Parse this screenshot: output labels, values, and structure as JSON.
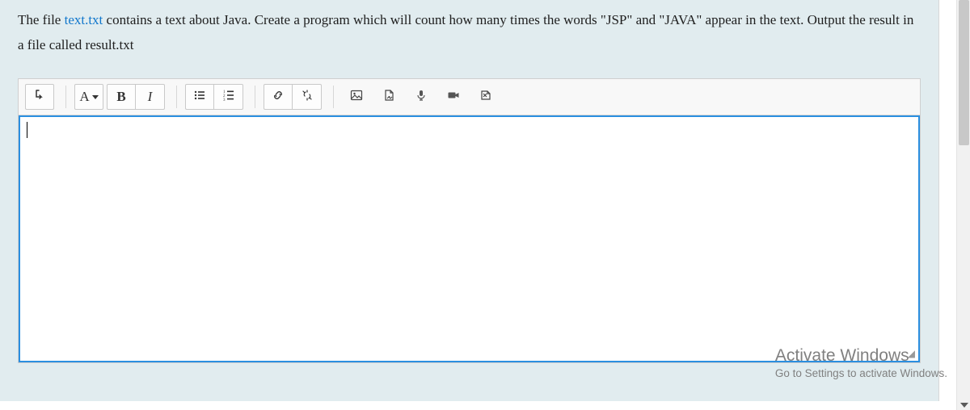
{
  "question": {
    "prefix": "The file ",
    "file_link": "text.txt",
    "suffix": " contains a text about Java. Create a program which will count how many times the words \"JSP\" and \"JAVA\" appear in the text. Output the result in a file called result.txt"
  },
  "toolbar": {
    "direction_icon": "ltr-arrow",
    "font_label": "A",
    "bold_label": "B",
    "italic_label": "I",
    "ul_icon": "unordered-list",
    "ol_icon": "ordered-list",
    "link_icon": "link",
    "unlink_icon": "code-symbol",
    "image_icon": "image",
    "file_icon": "file",
    "mic_icon": "microphone",
    "video_icon": "video",
    "preview_icon": "attachment"
  },
  "editor": {
    "content": ""
  },
  "watermark": {
    "title": "Activate Windows",
    "subtitle": "Go to Settings to activate Windows."
  }
}
